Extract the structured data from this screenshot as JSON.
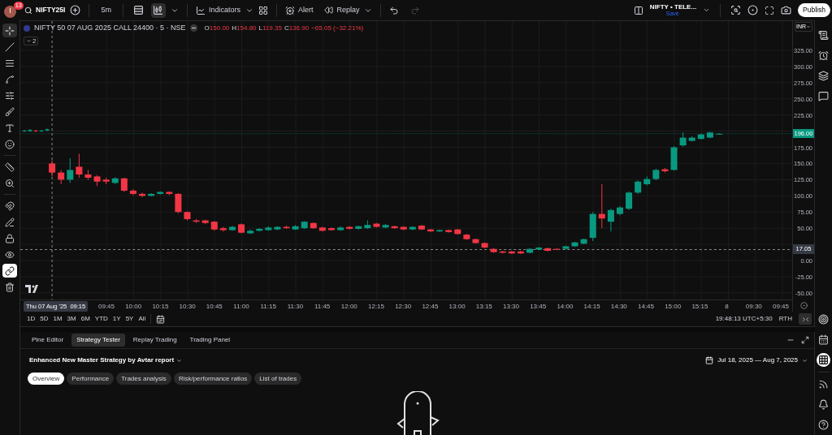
{
  "top_bar": {
    "avatar": {
      "initial": "I",
      "badge": "13"
    },
    "symbol": "NIFTY25I",
    "interval": "5m",
    "chart_types": [
      {
        "kind": "bars",
        "selected": false
      },
      {
        "kind": "candles",
        "selected": true
      }
    ],
    "indicators": "Indicators",
    "alert": "Alert",
    "replay": "Replay",
    "redo_disabled": true,
    "layout": {
      "name": "NIFTY • TELE...",
      "status": "Save"
    },
    "publish": "Publish"
  },
  "left_toolbar": [
    {
      "kind": "crosshair",
      "selected": true
    },
    {
      "kind": "trend-line",
      "selected": false
    },
    {
      "kind": "fib",
      "selected": false
    },
    {
      "kind": "pattern",
      "selected": false
    },
    {
      "kind": "projection",
      "selected": false
    },
    {
      "kind": "brush",
      "selected": false
    },
    {
      "kind": "text",
      "selected": false
    },
    {
      "kind": "emoji",
      "selected": false
    },
    {
      "kind": "ruler",
      "selected": false
    },
    {
      "kind": "zoom",
      "selected": false
    },
    {
      "kind": "magnet",
      "selected": false
    },
    {
      "kind": "draw-lock",
      "selected": false
    },
    {
      "kind": "lock",
      "selected": false
    },
    {
      "kind": "eye",
      "selected": false
    },
    {
      "kind": "link",
      "selected": true
    },
    {
      "kind": "trash",
      "selected": false
    }
  ],
  "legend": {
    "title": "NIFTY 50 07 AUG 2025 CALL 24400 · 5 · NSE",
    "ohlc": [
      {
        "key": "O",
        "value": "150.00"
      },
      {
        "key": "H",
        "value": "154.80"
      },
      {
        "key": "L",
        "value": "119.35"
      },
      {
        "key": "C",
        "value": "136.90"
      }
    ],
    "change": "−65.05 (−32.21%)",
    "indicator_count": "2"
  },
  "currency": "INR",
  "price_axis": [
    "325.00",
    "300.00",
    "275.00",
    "250.00",
    "225.00",
    "175.00",
    "150.00",
    "125.00",
    "100.00",
    "75.00",
    "50.00",
    "0.00",
    "-25.00",
    "-50.00"
  ],
  "price_labels": [
    {
      "text": "196.00",
      "kind": "last"
    },
    {
      "text": "17.05",
      "kind": "crosshair"
    }
  ],
  "time_axis": [
    "09:45",
    "10:00",
    "10:15",
    "10:30",
    "10:45",
    "11:00",
    "11:15",
    "11:30",
    "11:45",
    "12:00",
    "12:15",
    "12:30",
    "12:45",
    "13:00",
    "13:15",
    "13:30",
    "13:45",
    "14:00",
    "14:15",
    "14:30",
    "14:45",
    "15:00",
    "15:15",
    "8",
    "09:30",
    "09:45"
  ],
  "crosshair_time": {
    "date": "Thu 07 Aug '25",
    "time": "09:15"
  },
  "range_bar": {
    "ranges": [
      "1D",
      "5D",
      "1M",
      "3M",
      "6M",
      "YTD",
      "1Y",
      "5Y",
      "All"
    ],
    "clock": "19:48:13 UTC+5:30",
    "session": "RTH"
  },
  "right_sidebar": [
    {
      "kind": "watchlist",
      "selected": false
    },
    {
      "kind": "alerts",
      "selected": false
    },
    {
      "kind": "layers",
      "selected": false
    },
    {
      "kind": "chat",
      "selected": false
    },
    {
      "kind": "target",
      "selected": false
    },
    {
      "kind": "calendar",
      "selected": false
    },
    {
      "kind": "grid",
      "selected": true
    },
    {
      "kind": "rss",
      "selected": false
    },
    {
      "kind": "bell",
      "selected": false
    },
    {
      "kind": "help",
      "selected": false
    }
  ],
  "bottom_panel": {
    "tabs": [
      {
        "label": "Pine Editor",
        "selected": false
      },
      {
        "label": "Strategy Tester",
        "selected": true
      },
      {
        "label": "Replay Trading",
        "selected": false
      },
      {
        "label": "Trading Panel",
        "selected": false
      }
    ],
    "strategy": "Enhanced New Master Strategy by Avtar report",
    "date_range": "Jul 18, 2025 — Aug 7, 2025",
    "subtabs": [
      {
        "label": "Overview",
        "selected": true
      },
      {
        "label": "Performance",
        "selected": false
      },
      {
        "label": "Trades analysis",
        "selected": false
      },
      {
        "label": "Risk/performance ratios",
        "selected": false
      },
      {
        "label": "List of trades",
        "selected": false
      }
    ]
  }
}
